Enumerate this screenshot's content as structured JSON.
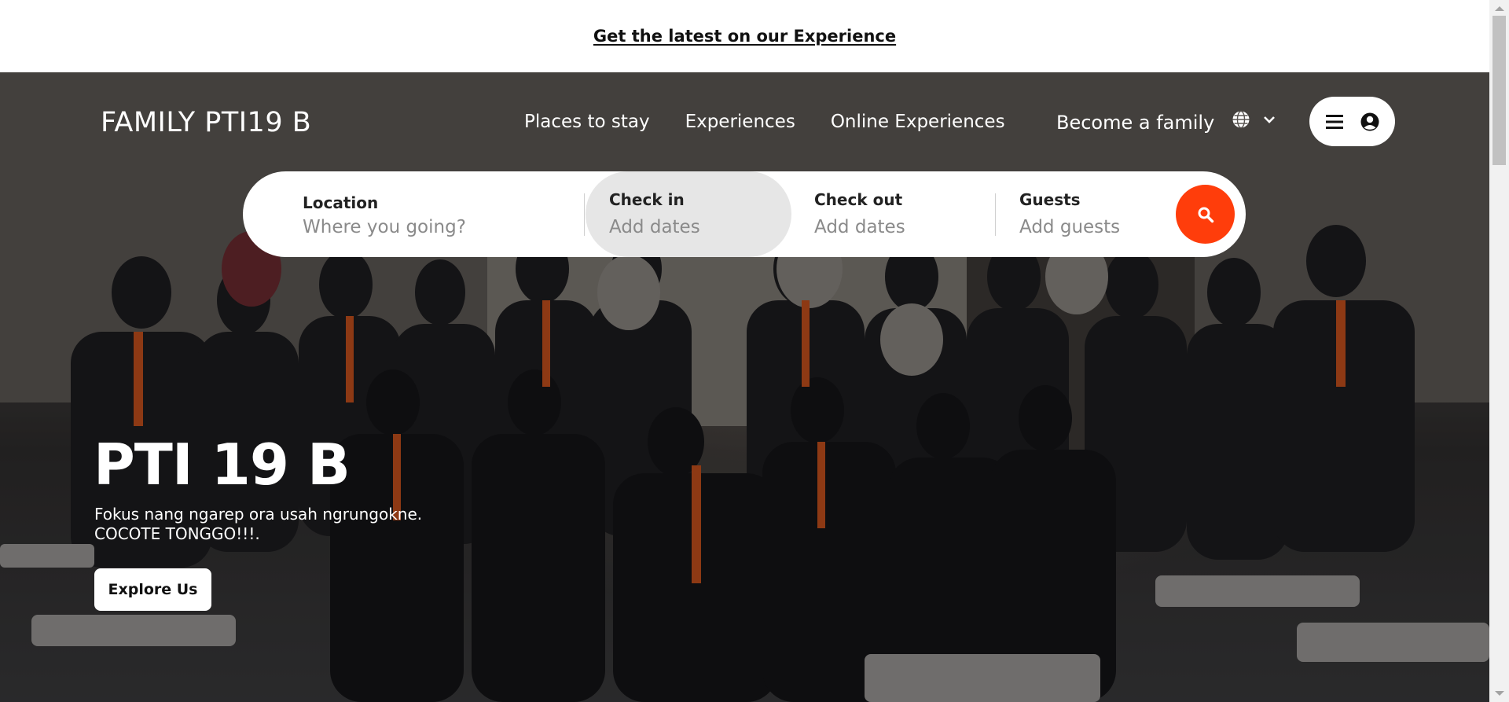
{
  "topbar": {
    "link_text": "Get the latest on our Experience"
  },
  "nav": {
    "logo": "FAMILY PTI19 B",
    "links": [
      "Places to stay",
      "Experiences",
      "Online Experiences"
    ],
    "become": "Become a family",
    "language_icon": "globe-icon",
    "dropdown_icon": "chevron-down-icon",
    "menu_icon": "hamburger-icon",
    "user_icon": "user-circle-icon"
  },
  "search": {
    "location": {
      "label": "Location",
      "placeholder": "Where you going?"
    },
    "check_in": {
      "label": "Check in",
      "value": "Add dates"
    },
    "check_out": {
      "label": "Check out",
      "value": "Add dates"
    },
    "guests": {
      "label": "Guests",
      "value": "Add guests"
    },
    "button_icon": "search-icon",
    "button_color": "#ff3d0b"
  },
  "hero": {
    "title": "PTI 19 B",
    "subtitle_line1": "Fokus nang ngarep ora usah ngrungokne.",
    "subtitle_line2": "COCOTE TONGGO!!!.",
    "cta": "Explore Us"
  }
}
